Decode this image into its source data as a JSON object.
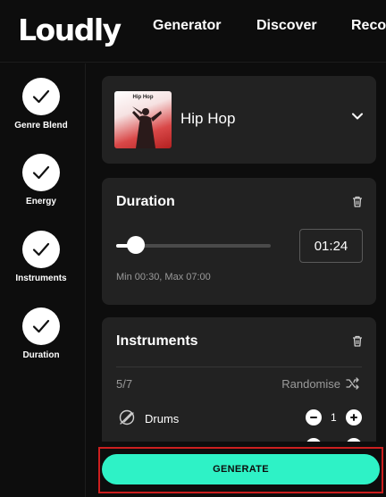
{
  "brand": {
    "logo_text": "Loudly"
  },
  "nav": {
    "items": [
      "Generator",
      "Discover",
      "Reco"
    ]
  },
  "steps": [
    {
      "label": "Genre Blend",
      "completed": true
    },
    {
      "label": "Energy",
      "completed": true
    },
    {
      "label": "Instruments",
      "completed": true
    },
    {
      "label": "Duration",
      "completed": true
    }
  ],
  "genre": {
    "thumbnail_title": "Hip Hop",
    "name": "Hip Hop"
  },
  "duration": {
    "title": "Duration",
    "value": "01:24",
    "range_text": "Min 00:30, Max 07:00",
    "slider_fraction": 0.13
  },
  "instruments": {
    "title": "Instruments",
    "count": "5/7",
    "randomise_label": "Randomise",
    "items": [
      {
        "name": "Drums",
        "quantity": "1"
      }
    ]
  },
  "generate": {
    "label": "GENERATE"
  },
  "colors": {
    "accent": "#2ef2c6",
    "highlight": "#cc1f1f",
    "card": "#222222",
    "background": "#0d0d0d"
  }
}
